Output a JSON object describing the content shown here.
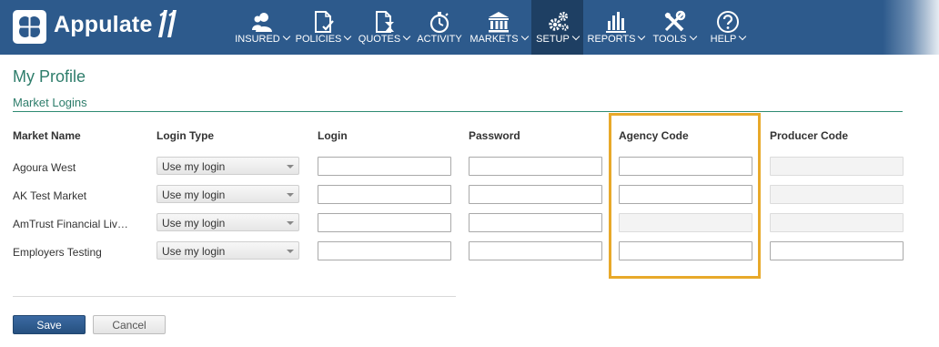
{
  "app": {
    "brand": "Appulate",
    "brand_mark": "11"
  },
  "nav": {
    "items": [
      {
        "label": "INSURED",
        "icon": "people-icon",
        "dropdown": true
      },
      {
        "label": "POLICIES",
        "icon": "document-check-icon",
        "dropdown": true
      },
      {
        "label": "QUOTES",
        "icon": "document-hourglass-icon",
        "dropdown": true
      },
      {
        "label": "ACTIVITY",
        "icon": "stopwatch-icon",
        "dropdown": false
      },
      {
        "label": "MARKETS",
        "icon": "bank-icon",
        "dropdown": true
      },
      {
        "label": "SETUP",
        "icon": "gears-icon",
        "dropdown": true,
        "active": true
      },
      {
        "label": "REPORTS",
        "icon": "bar-chart-icon",
        "dropdown": true
      },
      {
        "label": "TOOLS",
        "icon": "tools-icon",
        "dropdown": true
      },
      {
        "label": "HELP",
        "icon": "question-circle-icon",
        "dropdown": true
      }
    ]
  },
  "page": {
    "title": "My Profile",
    "section": "Market Logins"
  },
  "table": {
    "headers": [
      "Market Name",
      "Login Type",
      "Login",
      "Password",
      "Agency Code",
      "Producer Code"
    ],
    "rows": [
      {
        "market": "Agoura West",
        "login_type": "Use my login",
        "agency_disabled": false,
        "producer_disabled": true
      },
      {
        "market": "AK Test Market",
        "login_type": "Use my login",
        "agency_disabled": false,
        "producer_disabled": true
      },
      {
        "market": "AmTrust Financial Liv…",
        "login_type": "Use my login",
        "agency_disabled": true,
        "producer_disabled": true
      },
      {
        "market": "Employers Testing",
        "login_type": "Use my login",
        "agency_disabled": false,
        "producer_disabled": false
      }
    ]
  },
  "buttons": {
    "save": "Save",
    "cancel": "Cancel"
  },
  "colors": {
    "nav_bg": "#2d5a8c",
    "nav_active": "#1e3f63",
    "accent_green": "#2e7d6b",
    "highlight": "#e8a92a"
  }
}
